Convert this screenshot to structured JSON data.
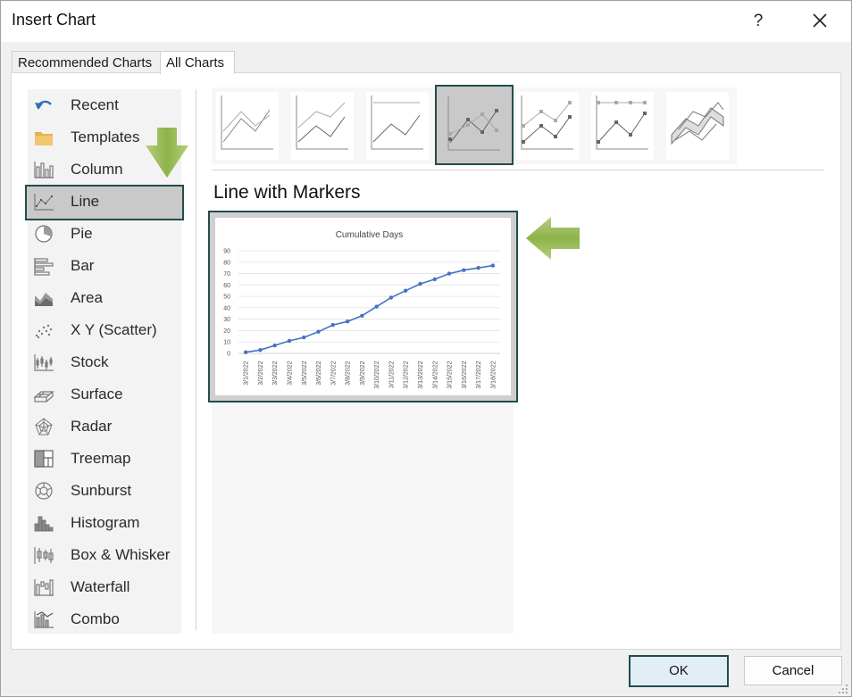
{
  "window": {
    "title": "Insert Chart",
    "help_label": "?"
  },
  "tabs": [
    {
      "label": "Recommended Charts",
      "active": false
    },
    {
      "label": "All Charts",
      "active": true
    }
  ],
  "sidebar": {
    "selected": "Line",
    "items": [
      {
        "label": "Recent",
        "icon": "undo-arrow-icon"
      },
      {
        "label": "Templates",
        "icon": "folder-icon"
      },
      {
        "label": "Column",
        "icon": "column-chart-icon"
      },
      {
        "label": "Line",
        "icon": "line-chart-icon"
      },
      {
        "label": "Pie",
        "icon": "pie-chart-icon"
      },
      {
        "label": "Bar",
        "icon": "bar-chart-icon"
      },
      {
        "label": "Area",
        "icon": "area-chart-icon"
      },
      {
        "label": "X Y (Scatter)",
        "icon": "scatter-chart-icon"
      },
      {
        "label": "Stock",
        "icon": "stock-chart-icon"
      },
      {
        "label": "Surface",
        "icon": "surface-chart-icon"
      },
      {
        "label": "Radar",
        "icon": "radar-chart-icon"
      },
      {
        "label": "Treemap",
        "icon": "treemap-chart-icon"
      },
      {
        "label": "Sunburst",
        "icon": "sunburst-chart-icon"
      },
      {
        "label": "Histogram",
        "icon": "histogram-chart-icon"
      },
      {
        "label": "Box & Whisker",
        "icon": "box-whisker-chart-icon"
      },
      {
        "label": "Waterfall",
        "icon": "waterfall-chart-icon"
      },
      {
        "label": "Combo",
        "icon": "combo-chart-icon"
      }
    ]
  },
  "subtypes": {
    "selected_title": "Line with Markers",
    "selected_index": 3,
    "items": [
      "line",
      "stacked-line",
      "100-stacked-line",
      "line-with-markers",
      "stacked-line-with-markers",
      "100-stacked-line-with-markers",
      "3d-line"
    ]
  },
  "preview": {
    "chart_data": {
      "type": "line",
      "title": "Cumulative Days",
      "x": [
        "3/1/2022",
        "3/2/2022",
        "3/3/2022",
        "3/4/2022",
        "3/5/2022",
        "3/6/2022",
        "3/7/2022",
        "3/8/2022",
        "3/9/2022",
        "3/10/2022",
        "3/11/2022",
        "3/12/2022",
        "3/13/2022",
        "3/14/2022",
        "3/15/2022",
        "3/16/2022",
        "3/17/2022",
        "3/18/2022"
      ],
      "series": [
        {
          "values": [
            1,
            3,
            7,
            11,
            14,
            19,
            25,
            28,
            33,
            41,
            49,
            55,
            61,
            65,
            70,
            73,
            75,
            77
          ],
          "color": "#4472c4",
          "markers": true
        }
      ],
      "yticks": [
        0,
        10,
        20,
        30,
        40,
        50,
        60,
        70,
        80,
        90
      ],
      "ylim": [
        0,
        90
      ],
      "grid": true
    }
  },
  "buttons": {
    "ok": "OK",
    "cancel": "Cancel"
  },
  "colors": {
    "selection_border": "#1f4d4d",
    "selection_fill": "#c9c9c9",
    "series": "#4472c4",
    "callout_arrow": "#8db34a"
  }
}
